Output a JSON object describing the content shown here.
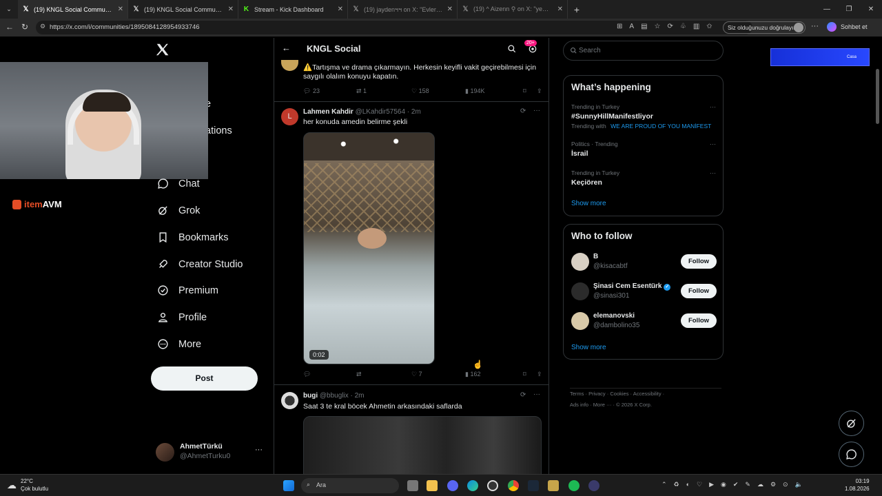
{
  "browser": {
    "tabs": [
      {
        "title": "(19) KNGL Social Community / X",
        "active": true,
        "icon": "x-logo"
      },
      {
        "title": "(19) KNGL Social Community / X",
        "active": false,
        "icon": "x-logo"
      },
      {
        "title": "Stream - Kick Dashboard",
        "active": false,
        "icon": "kick-logo"
      },
      {
        "title": "(19) jaydenฯฯ on X: \"Evleri yakın o",
        "active": false,
        "icon": "x-logo"
      },
      {
        "title": "(19) ^ Aizenn ⚲ on X: \"yemek ya",
        "active": false,
        "icon": "x-logo"
      }
    ],
    "url": "https://x.com/i/communities/1895084128954933746",
    "verify_text": "Siz olduğunuzu doğrulayın",
    "chat_label": "Sohbet et"
  },
  "overlay": {
    "brand_item": "item",
    "brand_avm": "AVM",
    "partial_nav_1": "e",
    "partial_nav_2": "ations"
  },
  "sidebar": {
    "items": [
      {
        "label": "Chat",
        "icon": "chat-icon"
      },
      {
        "label": "Grok",
        "icon": "grok-icon"
      },
      {
        "label": "Bookmarks",
        "icon": "bookmark-icon"
      },
      {
        "label": "Creator Studio",
        "icon": "rocket-icon"
      },
      {
        "label": "Premium",
        "icon": "verified-icon"
      },
      {
        "label": "Profile",
        "icon": "person-icon"
      },
      {
        "label": "More",
        "icon": "more-circle-icon"
      }
    ],
    "post_label": "Post",
    "account": {
      "name": "AhmetTürkü",
      "handle": "@AhmetTurku0"
    }
  },
  "header": {
    "title": "KNGL Social",
    "badge": "20+"
  },
  "feed": {
    "pinned": {
      "text": "⚠️Tartışma ve drama çıkarmayın. Herkesin keyifli vakit geçirebilmesi için saygılı olalım konuyu kapatın.",
      "replies": "23",
      "reposts": "1",
      "likes": "158",
      "views": "194K"
    },
    "tweet1": {
      "name": "Lahmen Kahdir",
      "handle": "@LKahdir57564",
      "time": "· 2m",
      "text": "her konuda amedin belirme şekli",
      "avatar_letter": "L",
      "video_time": "0:02",
      "replies": "",
      "reposts": "",
      "likes": "7",
      "views": "162"
    },
    "tweet2": {
      "name": "bugi",
      "handle": "@bbuglix",
      "time": "· 2m",
      "text": "Saat 3 te kral böcek Ahmetin arkasındaki saflarda"
    }
  },
  "right": {
    "search_placeholder": "Search",
    "happening_title": "What’s happening",
    "trends": [
      {
        "meta": "Trending in Turkey",
        "name": "#SunnyHillManifestliyor",
        "extra_prefix": "Trending with",
        "extra_link": "WE ARE PROUD OF YOU MANİFEST"
      },
      {
        "meta": "Politics · Trending",
        "name": "İsrail"
      },
      {
        "meta": "Trending in Turkey",
        "name": "Keçiören"
      }
    ],
    "show_more": "Show more",
    "who_title": "Who to follow",
    "follows": [
      {
        "name": "B",
        "handle": "@kisacabtf",
        "verified": false
      },
      {
        "name": "Şinasi Cem Esentürk",
        "handle": "@sinasi301",
        "verified": true
      },
      {
        "name": "elemanovski",
        "handle": "@dambolino35",
        "verified": false
      }
    ],
    "follow_label": "Follow",
    "footer": [
      "Terms",
      "Privacy",
      "Cookies",
      "Accessibility",
      "Ads info",
      "More ···",
      "© 2026 X Corp."
    ],
    "ad_text": "Casa"
  },
  "taskbar": {
    "temp": "22°C",
    "weather": "Çok bulutlu",
    "search": "Ara",
    "time": "03:19",
    "date": "1.08.2026"
  },
  "colors": {
    "accent": "#1d9bf0",
    "badge": "#f91880",
    "bg": "#000000",
    "border": "#2f3336"
  }
}
